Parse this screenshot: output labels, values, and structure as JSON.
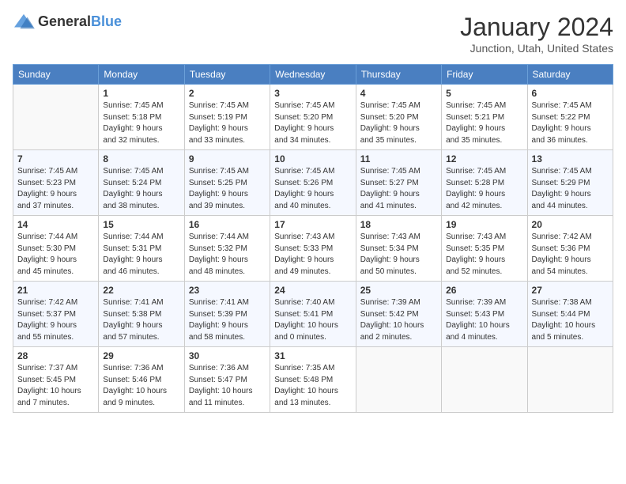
{
  "header": {
    "logo_general": "General",
    "logo_blue": "Blue",
    "month_year": "January 2024",
    "location": "Junction, Utah, United States"
  },
  "days_of_week": [
    "Sunday",
    "Monday",
    "Tuesday",
    "Wednesday",
    "Thursday",
    "Friday",
    "Saturday"
  ],
  "weeks": [
    [
      {
        "day": "",
        "info": ""
      },
      {
        "day": "1",
        "info": "Sunrise: 7:45 AM\nSunset: 5:18 PM\nDaylight: 9 hours\nand 32 minutes."
      },
      {
        "day": "2",
        "info": "Sunrise: 7:45 AM\nSunset: 5:19 PM\nDaylight: 9 hours\nand 33 minutes."
      },
      {
        "day": "3",
        "info": "Sunrise: 7:45 AM\nSunset: 5:20 PM\nDaylight: 9 hours\nand 34 minutes."
      },
      {
        "day": "4",
        "info": "Sunrise: 7:45 AM\nSunset: 5:20 PM\nDaylight: 9 hours\nand 35 minutes."
      },
      {
        "day": "5",
        "info": "Sunrise: 7:45 AM\nSunset: 5:21 PM\nDaylight: 9 hours\nand 35 minutes."
      },
      {
        "day": "6",
        "info": "Sunrise: 7:45 AM\nSunset: 5:22 PM\nDaylight: 9 hours\nand 36 minutes."
      }
    ],
    [
      {
        "day": "7",
        "info": "Sunrise: 7:45 AM\nSunset: 5:23 PM\nDaylight: 9 hours\nand 37 minutes."
      },
      {
        "day": "8",
        "info": "Sunrise: 7:45 AM\nSunset: 5:24 PM\nDaylight: 9 hours\nand 38 minutes."
      },
      {
        "day": "9",
        "info": "Sunrise: 7:45 AM\nSunset: 5:25 PM\nDaylight: 9 hours\nand 39 minutes."
      },
      {
        "day": "10",
        "info": "Sunrise: 7:45 AM\nSunset: 5:26 PM\nDaylight: 9 hours\nand 40 minutes."
      },
      {
        "day": "11",
        "info": "Sunrise: 7:45 AM\nSunset: 5:27 PM\nDaylight: 9 hours\nand 41 minutes."
      },
      {
        "day": "12",
        "info": "Sunrise: 7:45 AM\nSunset: 5:28 PM\nDaylight: 9 hours\nand 42 minutes."
      },
      {
        "day": "13",
        "info": "Sunrise: 7:45 AM\nSunset: 5:29 PM\nDaylight: 9 hours\nand 44 minutes."
      }
    ],
    [
      {
        "day": "14",
        "info": "Sunrise: 7:44 AM\nSunset: 5:30 PM\nDaylight: 9 hours\nand 45 minutes."
      },
      {
        "day": "15",
        "info": "Sunrise: 7:44 AM\nSunset: 5:31 PM\nDaylight: 9 hours\nand 46 minutes."
      },
      {
        "day": "16",
        "info": "Sunrise: 7:44 AM\nSunset: 5:32 PM\nDaylight: 9 hours\nand 48 minutes."
      },
      {
        "day": "17",
        "info": "Sunrise: 7:43 AM\nSunset: 5:33 PM\nDaylight: 9 hours\nand 49 minutes."
      },
      {
        "day": "18",
        "info": "Sunrise: 7:43 AM\nSunset: 5:34 PM\nDaylight: 9 hours\nand 50 minutes."
      },
      {
        "day": "19",
        "info": "Sunrise: 7:43 AM\nSunset: 5:35 PM\nDaylight: 9 hours\nand 52 minutes."
      },
      {
        "day": "20",
        "info": "Sunrise: 7:42 AM\nSunset: 5:36 PM\nDaylight: 9 hours\nand 54 minutes."
      }
    ],
    [
      {
        "day": "21",
        "info": "Sunrise: 7:42 AM\nSunset: 5:37 PM\nDaylight: 9 hours\nand 55 minutes."
      },
      {
        "day": "22",
        "info": "Sunrise: 7:41 AM\nSunset: 5:38 PM\nDaylight: 9 hours\nand 57 minutes."
      },
      {
        "day": "23",
        "info": "Sunrise: 7:41 AM\nSunset: 5:39 PM\nDaylight: 9 hours\nand 58 minutes."
      },
      {
        "day": "24",
        "info": "Sunrise: 7:40 AM\nSunset: 5:41 PM\nDaylight: 10 hours\nand 0 minutes."
      },
      {
        "day": "25",
        "info": "Sunrise: 7:39 AM\nSunset: 5:42 PM\nDaylight: 10 hours\nand 2 minutes."
      },
      {
        "day": "26",
        "info": "Sunrise: 7:39 AM\nSunset: 5:43 PM\nDaylight: 10 hours\nand 4 minutes."
      },
      {
        "day": "27",
        "info": "Sunrise: 7:38 AM\nSunset: 5:44 PM\nDaylight: 10 hours\nand 5 minutes."
      }
    ],
    [
      {
        "day": "28",
        "info": "Sunrise: 7:37 AM\nSunset: 5:45 PM\nDaylight: 10 hours\nand 7 minutes."
      },
      {
        "day": "29",
        "info": "Sunrise: 7:36 AM\nSunset: 5:46 PM\nDaylight: 10 hours\nand 9 minutes."
      },
      {
        "day": "30",
        "info": "Sunrise: 7:36 AM\nSunset: 5:47 PM\nDaylight: 10 hours\nand 11 minutes."
      },
      {
        "day": "31",
        "info": "Sunrise: 7:35 AM\nSunset: 5:48 PM\nDaylight: 10 hours\nand 13 minutes."
      },
      {
        "day": "",
        "info": ""
      },
      {
        "day": "",
        "info": ""
      },
      {
        "day": "",
        "info": ""
      }
    ]
  ]
}
